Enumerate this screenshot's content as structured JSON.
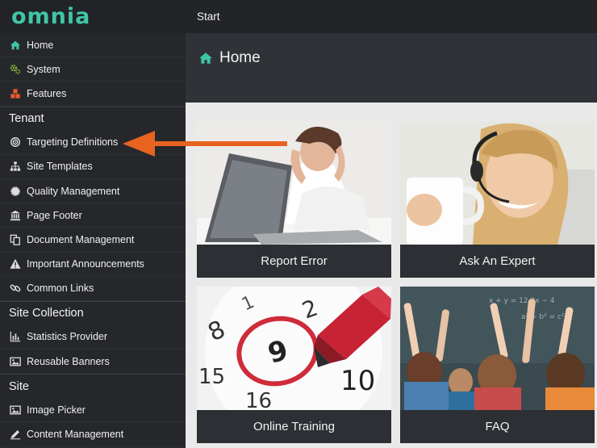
{
  "app": {
    "logo": "omnia",
    "breadcrumb": "Start"
  },
  "header": {
    "title": "Home"
  },
  "sidebar": {
    "top_items": [
      {
        "label": "Home"
      },
      {
        "label": "System"
      },
      {
        "label": "Features"
      }
    ],
    "sections": [
      {
        "title": "Tenant",
        "items": [
          {
            "label": "Targeting Definitions"
          },
          {
            "label": "Site Templates"
          },
          {
            "label": "Quality Management"
          },
          {
            "label": "Page Footer"
          },
          {
            "label": "Document Management"
          },
          {
            "label": "Important Announcements"
          },
          {
            "label": "Common Links"
          }
        ]
      },
      {
        "title": "Site Collection",
        "items": [
          {
            "label": "Statistics Provider"
          },
          {
            "label": "Reusable Banners"
          }
        ]
      },
      {
        "title": "Site",
        "items": [
          {
            "label": "Image Picker"
          },
          {
            "label": "Content Management"
          }
        ]
      }
    ]
  },
  "tiles": [
    {
      "label": "Report Error"
    },
    {
      "label": "Ask An Expert"
    },
    {
      "label": "Online Training"
    },
    {
      "label": "FAQ"
    }
  ],
  "colors": {
    "accent": "#3fc6a6",
    "arrow": "#e8631f",
    "sidebar": "#25272b"
  }
}
